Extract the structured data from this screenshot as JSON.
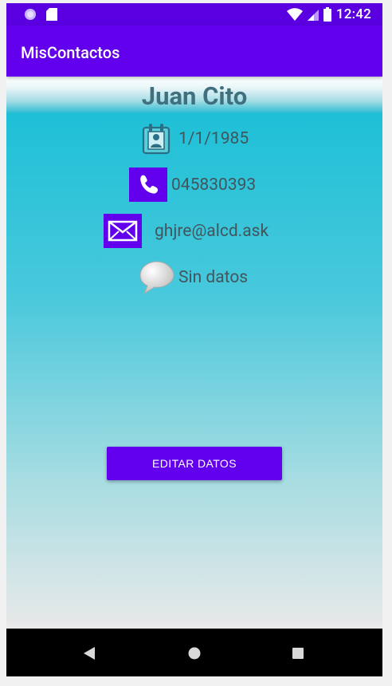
{
  "status_bar": {
    "time": "12:42",
    "icons": [
      "notification-circle-icon",
      "sd-card-icon",
      "wifi-icon",
      "signal-icon",
      "battery-icon"
    ]
  },
  "app_bar": {
    "title": "MisContactos"
  },
  "contact": {
    "name": "Juan Cito",
    "birthday": "1/1/1985",
    "phone": "045830393",
    "email": "ghjre@alcd.ask",
    "comment": "Sin datos"
  },
  "actions": {
    "edit_label": "EDITAR DATOS"
  },
  "nav_bar": {
    "icons": [
      "back-icon",
      "home-icon",
      "recents-icon"
    ]
  },
  "colors": {
    "primary": "#6200ee",
    "status_bar": "#5a00e0",
    "accent_cyan": "#1ec0d7",
    "name_text": "#40707d"
  }
}
